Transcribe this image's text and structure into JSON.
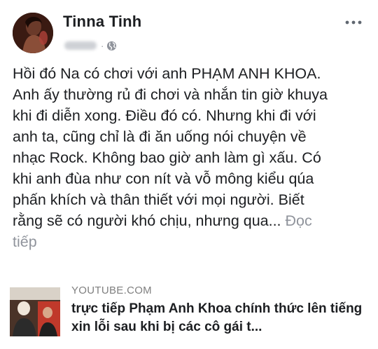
{
  "post": {
    "author": "Tinna Tinh",
    "body_text": "Hồi đó Na có chơi với anh PHẠM ANH KHOA.\nAnh ấy thường rủ đi chơi và nhắn tin giờ khuya\nkhi đi diễn xong. Điều đó có. Nhưng khi đi với\nanh ta, cũng chỉ là đi ăn uống nói chuyện về\nnhạc Rock. Không bao giờ anh làm gì xấu. Có\nkhi anh đùa như con nít và vỗ mông kiểu qúa\nphấn khích và thân thiết với mọi người. Biết\nrằng sẽ có người khó chịu, nhưng qua... ",
    "see_more": "Đọc\ntiếp",
    "meta_separator": "·",
    "privacy_icon": "globe-icon",
    "menu_icon": "more-horizontal-icon"
  },
  "link_preview": {
    "source": "YOUTUBE.COM",
    "headline": "trực tiếp Phạm Anh Khoa chính thức lên tiếng xin lỗi sau khi bị các cô gái t..."
  },
  "colors": {
    "text": "#1c1e21",
    "muted": "#90949c",
    "source": "#7f7f7f"
  }
}
